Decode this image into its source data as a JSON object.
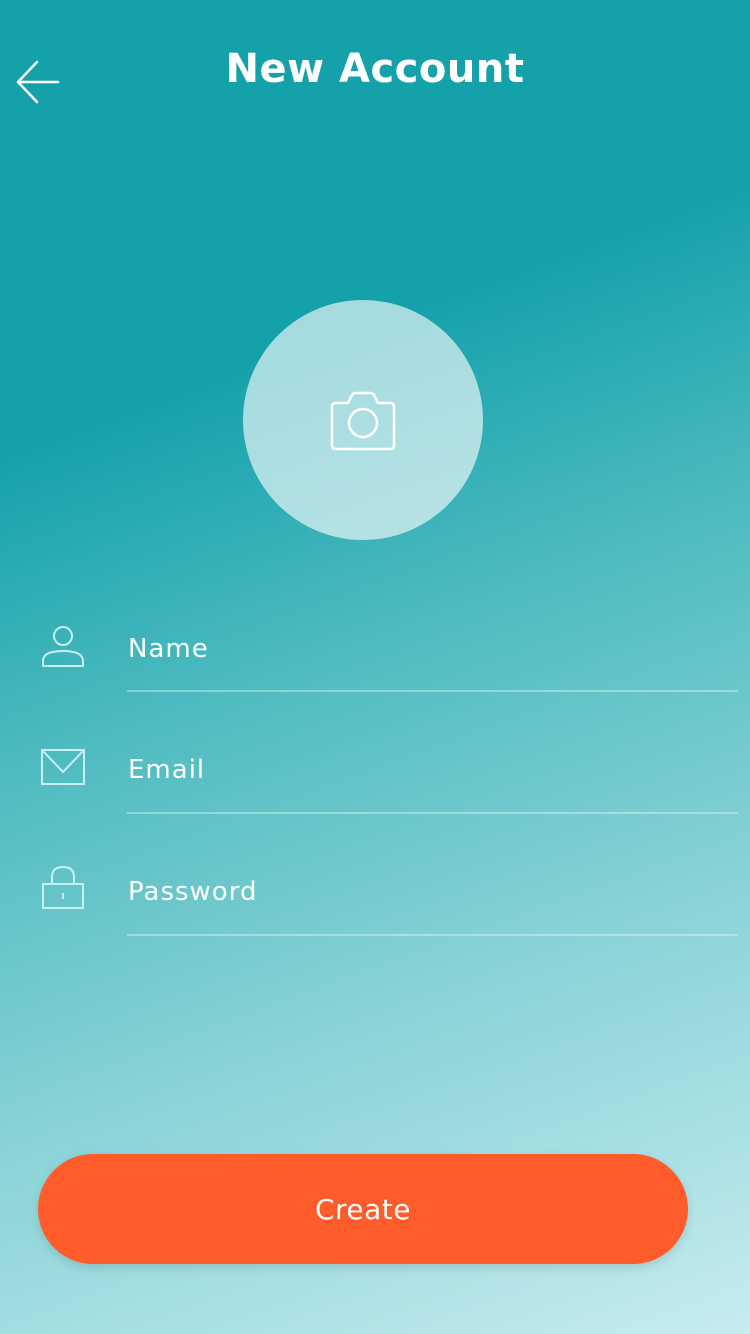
{
  "header": {
    "title": "New Account",
    "back_icon": "arrow-left-icon"
  },
  "avatar": {
    "icon": "camera-icon"
  },
  "form": {
    "name": {
      "icon": "user-icon",
      "value": "",
      "placeholder": "Name"
    },
    "email": {
      "icon": "envelope-icon",
      "value": "",
      "placeholder": "Email"
    },
    "password": {
      "icon": "lock-icon",
      "value": "",
      "placeholder": "Password"
    }
  },
  "actions": {
    "create_label": "Create"
  },
  "colors": {
    "gradient_top": "#14a1aa",
    "gradient_bottom": "#c6ecee",
    "accent": "#ff5b2b",
    "text": "#ffffff"
  }
}
